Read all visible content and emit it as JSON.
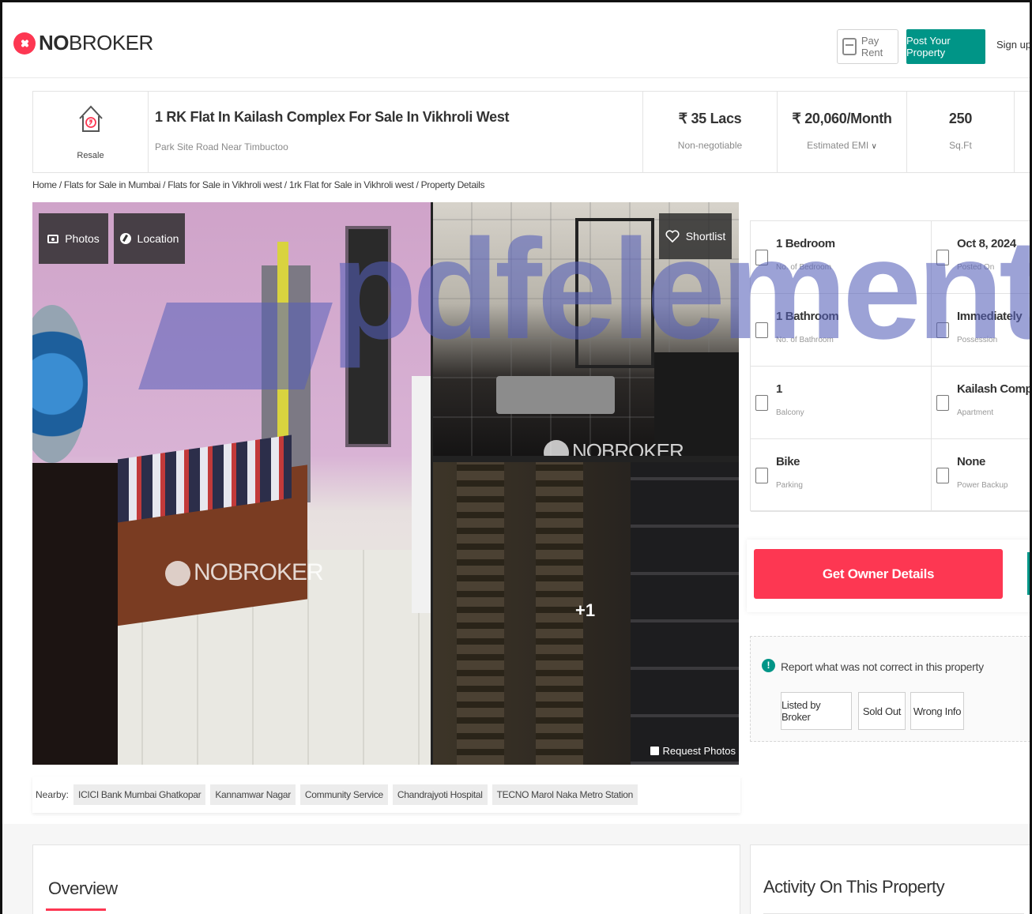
{
  "header": {
    "logo_bold": "NO",
    "logo_rest": "BROKER",
    "pay_rent": "Pay Rent",
    "post_property": "Post Your Property",
    "signup": "Sign up"
  },
  "summary": {
    "type_label": "Resale",
    "title": "1 RK Flat In Kailash Complex For Sale In Vikhroli West",
    "address": "Park Site Road Near Timbuctoo",
    "price": "₹ 35 Lacs",
    "price_note": "Non-negotiable",
    "emi": "₹ 20,060/Month",
    "emi_note": "Estimated EMI",
    "area": "250",
    "area_unit": "Sq.Ft"
  },
  "breadcrumb": "Home / Flats for Sale in Mumbai / Flats for Sale in Vikhroli west / 1rk Flat for Sale in Vikhroli west / Property Details",
  "gallery": {
    "photos": "Photos",
    "location": "Location",
    "shortlist": "Shortlist",
    "more_count": "+1",
    "request_photos": "Request Photos",
    "watermark": "NOBROKER"
  },
  "nearby": {
    "label": "Nearby:",
    "places": [
      "ICICI Bank Mumbai Ghatkopar",
      "Kannamwar Nagar",
      "Community Service",
      "Chandrajyoti Hospital",
      "TECNO Marol Naka Metro Station"
    ]
  },
  "details": [
    {
      "value": "1 Bedroom",
      "label": "No. of Bedroom",
      "icon": "bed-icon"
    },
    {
      "value": "Oct 8, 2024",
      "label": "Posted On",
      "icon": "calendar-icon"
    },
    {
      "value": "1 Bathroom",
      "label": "No. of Bathroom",
      "icon": "bathtub-icon"
    },
    {
      "value": "Immediately",
      "label": "Possession",
      "icon": "key-icon"
    },
    {
      "value": "1",
      "label": "Balcony",
      "icon": "balcony-icon"
    },
    {
      "value": "Kailash Complex",
      "label": "Apartment",
      "icon": "building-icon"
    },
    {
      "value": "Bike",
      "label": "Parking",
      "icon": "car-icon"
    },
    {
      "value": "None",
      "label": "Power Backup",
      "icon": "battery-icon"
    }
  ],
  "owner_button": "Get Owner Details",
  "report": {
    "title": "Report what was not correct in this property",
    "options": [
      "Listed by Broker",
      "Sold Out",
      "Wrong Info"
    ]
  },
  "overview_title": "Overview",
  "activity_title": "Activity On This Property",
  "watermark_text": "pdfelement",
  "colors": {
    "brand_red": "#fd3752",
    "brand_teal": "#009587"
  }
}
